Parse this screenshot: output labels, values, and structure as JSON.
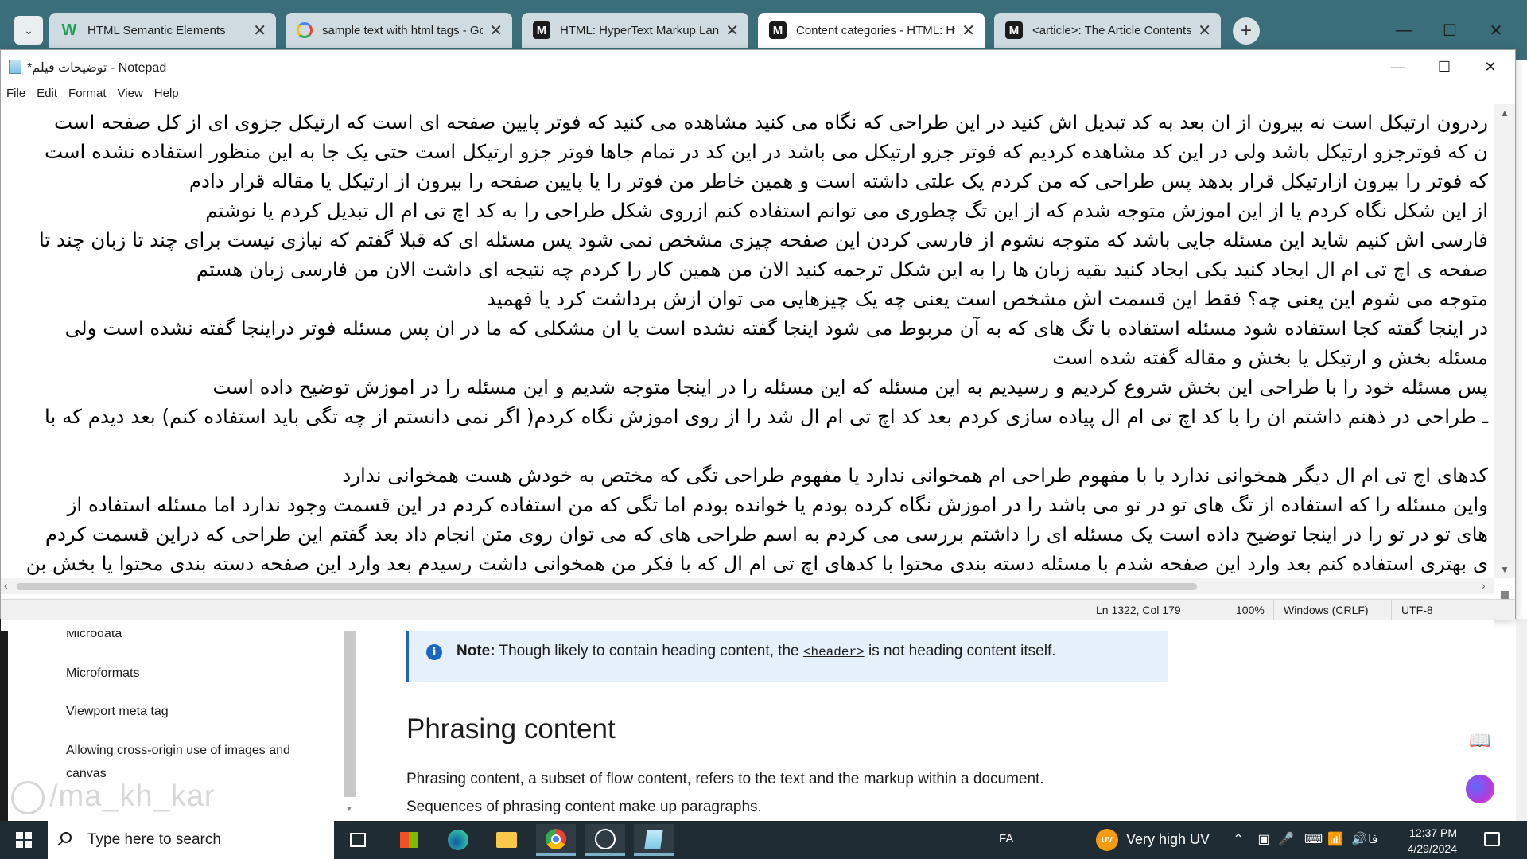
{
  "browser": {
    "tabs": [
      {
        "title": "HTML Semantic Elements",
        "favicon": "w3schools-icon",
        "fav_glyph": "W",
        "active": false
      },
      {
        "title": "sample text with html tags - Go",
        "favicon": "google-icon",
        "fav_glyph": "G",
        "active": false
      },
      {
        "title": "HTML: HyperText Markup Langu",
        "favicon": "mdn-icon",
        "fav_glyph": "M",
        "active": false
      },
      {
        "title": "Content categories - HTML: Hy",
        "favicon": "mdn-icon",
        "fav_glyph": "M",
        "active": true
      },
      {
        "title": "<article>: The Article Contents",
        "favicon": "mdn-icon",
        "fav_glyph": "M",
        "active": false
      }
    ],
    "close_glyph": "✕",
    "new_tab_glyph": "+"
  },
  "mdn": {
    "sidebar_items": [
      "Microdata",
      "Microformats",
      "Viewport meta tag",
      "Allowing cross-origin use of images and canvas"
    ],
    "note_label": "Note:",
    "note_text_before": " Though likely to contain heading content, the ",
    "note_code": "<header>",
    "note_text_after": " is not heading content itself.",
    "heading": "Phrasing content",
    "paragraph_line1": "Phrasing content, a subset of flow content, refers to the text and the markup within a document.",
    "paragraph_line2": "Sequences of phrasing content make up paragraphs.",
    "watermark": "/ma_kh_kar"
  },
  "notepad": {
    "title": "*توضیحات فیلم - Notepad",
    "menu": [
      "File",
      "Edit",
      "Format",
      "View",
      "Help"
    ],
    "lines": [
      "ردرون ارتیکل است نه بیرون از ان بعد به کد تبدیل اش کنید در این طراحی که نگاه می کنید مشاهده می کنید که فوتر پایین صفحه ای است که ارتیکل جزوی ای از کل صفحه است",
      "ن که فوترجزو ارتیکل باشد ولی در این کد مشاهده کردیم که فوتر جزو ارتیکل می باشد در این کد در تمام جاها فوتر جزو ارتیکل است حتی یک جا به این منظور استفاده نشده است",
      "که فوتر را بیرون ازارتیکل قرار بدهد پس طراحی که من کردم یک علتی داشته است و همین خاطر من فوتر را یا پایین صفحه را بیرون از ارتیکل یا مقاله قرار دادم",
      "از این شکل نگاه کردم یا از این اموزش متوجه شدم که از این تگ چطوری می توانم استفاده کنم ازروی شکل طراحی را به کد اچ تی ام ال تبدیل کردم یا نوشتم",
      "فارسی اش کنیم شاید این مسئله جایی باشد که متوجه نشوم  از فارسی کردن این صفحه چیزی مشخص نمی شود پس مسئله ای که قبلا گفتم که نیازی نیست برای چند تا زبان چند تا",
      "صفحه ی اچ تی ام ال ایجاد کنید یکی ایجاد کنید بقیه زبان ها را به این شکل ترجمه کنید الان من همین کار را کردم چه نتیجه ای داشت  الان من فارسی زبان هستم",
      "متوجه می شوم این یعنی چه؟ فقط این قسمت اش مشخص است یعنی چه یک چیزهایی می توان ازش برداشت کرد یا فهمید",
      "در اینجا گفته کجا استفاده شود  مسئله استفاده با تگ های که به آن مربوط می شود اینجا گفته نشده است  یا ان مشکلی که ما در ان پس مسئله فوتر دراینجا گفته نشده است ولی",
      "مسئله بخش و ارتیکل یا بخش و مقاله گفته شده است",
      "پس مسئله خود را با طراحی این بخش شروع کردیم  و رسیدیم به این مسئله  که این مسئله را در اینجا متوجه شدیم   و این مسئله را در اموزش توضیح داده است",
      "ـ طراحی در ذهنم داشتم ان  را  با کد اچ تی ام ال پیاده سازی کردم بعد کد اچ تی ام ال شد را از روی اموزش نگاه کردم( اگر نمی دانستم از چه تگی باید استفاده کنم) بعد دیدم که با",
      "",
      "کدهای اچ تی ام ال دیگر  همخوانی ندارد یا با مفهوم طراحی ام همخوانی ندارد  یا مفهوم طراحی تگی که مختص به خودش هست همخوانی ندارد",
      "واین مسئله را که استفاده از تگ های تو در تو می باشد را در اموزش نگاه کرده بودم یا خوانده بودم  اما تگی که من استفاده کردم در این قسمت وجود ندارد اما مسئله استفاده از",
      "های تو در تو را در اینجا توضیح داده است یک مسئله ای را داشتم بررسی می کردم به اسم طراحی های که می توان روی متن انجام داد بعد گفتم این طراحی که دراین قسمت کردم",
      "ی بهتری استفاده کنم بعد وارد این صفحه شدم با مسئله دسته بندی محتوا با کدهای اچ تی ام ال که با فکر من همخوانی داشت رسیدم بعد وارد این صفحه دسته بندی محتوا یا بخش بن"
    ],
    "status": {
      "position": "Ln 1322, Col 179",
      "zoom": "100%",
      "line_ending": "Windows (CRLF)",
      "encoding": "UTF-8"
    }
  },
  "taskbar": {
    "search_placeholder": "Type here to search",
    "input_language": "FA",
    "weather": "Very high UV",
    "uv_label": "UV",
    "ime": "فا",
    "time": "12:37 PM",
    "date": "4/29/2024"
  },
  "colors": {
    "browser_tabbar": "#3a6e7a",
    "taskbar": "#1f2c33",
    "mdn_note_accent": "#1a66c4"
  }
}
